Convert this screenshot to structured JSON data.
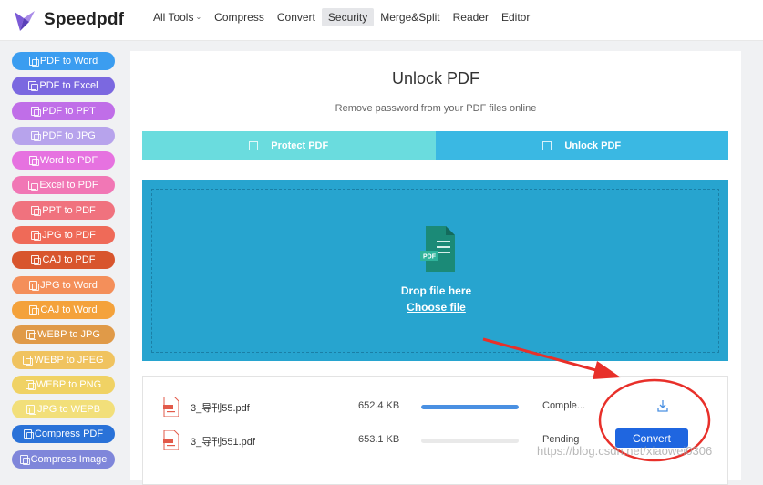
{
  "app": {
    "name": "Speedpdf"
  },
  "nav": [
    {
      "label": "All Tools",
      "dropdown": true
    },
    {
      "label": "Compress"
    },
    {
      "label": "Convert"
    },
    {
      "label": "Security",
      "active": true
    },
    {
      "label": "Merge&Split"
    },
    {
      "label": "Reader"
    },
    {
      "label": "Editor"
    }
  ],
  "sidebar": [
    {
      "label": "PDF to Word",
      "color": "#3b9df0"
    },
    {
      "label": "PDF to Excel",
      "color": "#7b68e0"
    },
    {
      "label": "PDF to PPT",
      "color": "#c06ee8"
    },
    {
      "label": "PDF to JPG",
      "color": "#b7a3ec"
    },
    {
      "label": "Word to PDF",
      "color": "#e672e0"
    },
    {
      "label": "Excel to PDF",
      "color": "#f177b5"
    },
    {
      "label": "PPT to PDF",
      "color": "#f0727e"
    },
    {
      "label": "JPG to PDF",
      "color": "#ef6a58"
    },
    {
      "label": "CAJ to PDF",
      "color": "#d8552d"
    },
    {
      "label": "JPG to Word",
      "color": "#f48f5a"
    },
    {
      "label": "CAJ to Word",
      "color": "#f4a23b"
    },
    {
      "label": "WEBP to JPG",
      "color": "#e09a48"
    },
    {
      "label": "WEBP to JPEG",
      "color": "#f0c35f"
    },
    {
      "label": "WEBP to PNG",
      "color": "#f0d264"
    },
    {
      "label": "JPG to WEPB",
      "color": "#f2df7a"
    },
    {
      "label": "Compress PDF",
      "color": "#2a72d8"
    },
    {
      "label": "Compress Image",
      "color": "#7f86da"
    }
  ],
  "main": {
    "title": "Unlock PDF",
    "subtitle": "Remove password from your PDF files online",
    "tabs": [
      {
        "label": "Protect PDF"
      },
      {
        "label": "Unlock PDF",
        "active": true
      }
    ],
    "dropzone": {
      "icon_text": "PDF",
      "drop_text": "Drop file here",
      "choose_text": "Choose file"
    },
    "files": [
      {
        "name": "3_导刊55.pdf",
        "size": "652.4 KB",
        "progress": 1.0,
        "status": "Comple..."
      },
      {
        "name": "3_导刊551.pdf",
        "size": "653.1 KB",
        "progress": 0.0,
        "status": "Pending",
        "action": "Convert"
      }
    ]
  },
  "watermark": "https://blog.csdn.net/xiaowei0306",
  "colors": {
    "annotation": "#e8302a",
    "protect_tab": "#6adcde",
    "unlock_tab": "#3ab8e3",
    "dropzone": "#27a4cf",
    "convert_button": "#1f66e0",
    "progress": "#4a90e2"
  }
}
